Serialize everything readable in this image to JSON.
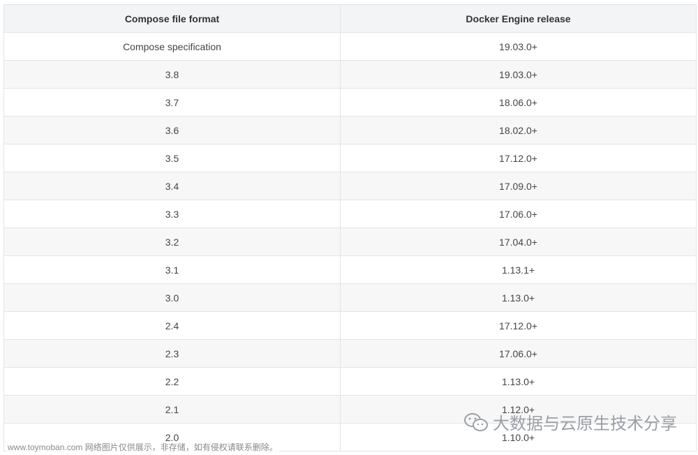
{
  "table": {
    "headers": [
      "Compose file format",
      "Docker Engine release"
    ],
    "rows": [
      [
        "Compose specification",
        "19.03.0+"
      ],
      [
        "3.8",
        "19.03.0+"
      ],
      [
        "3.7",
        "18.06.0+"
      ],
      [
        "3.6",
        "18.02.0+"
      ],
      [
        "3.5",
        "17.12.0+"
      ],
      [
        "3.4",
        "17.09.0+"
      ],
      [
        "3.3",
        "17.06.0+"
      ],
      [
        "3.2",
        "17.04.0+"
      ],
      [
        "3.1",
        "1.13.1+"
      ],
      [
        "3.0",
        "1.13.0+"
      ],
      [
        "2.4",
        "17.12.0+"
      ],
      [
        "2.3",
        "17.06.0+"
      ],
      [
        "2.2",
        "1.13.0+"
      ],
      [
        "2.1",
        "1.12.0+"
      ],
      [
        "2.0",
        "1.10.0+"
      ]
    ]
  },
  "watermarks": {
    "site_text": "www.toymoban.com 网络图片仅供展示，非存储，如有侵权请联系删除。",
    "account_text": "大数据与云原生技术分享",
    "account_icon": "wechat-icon"
  }
}
